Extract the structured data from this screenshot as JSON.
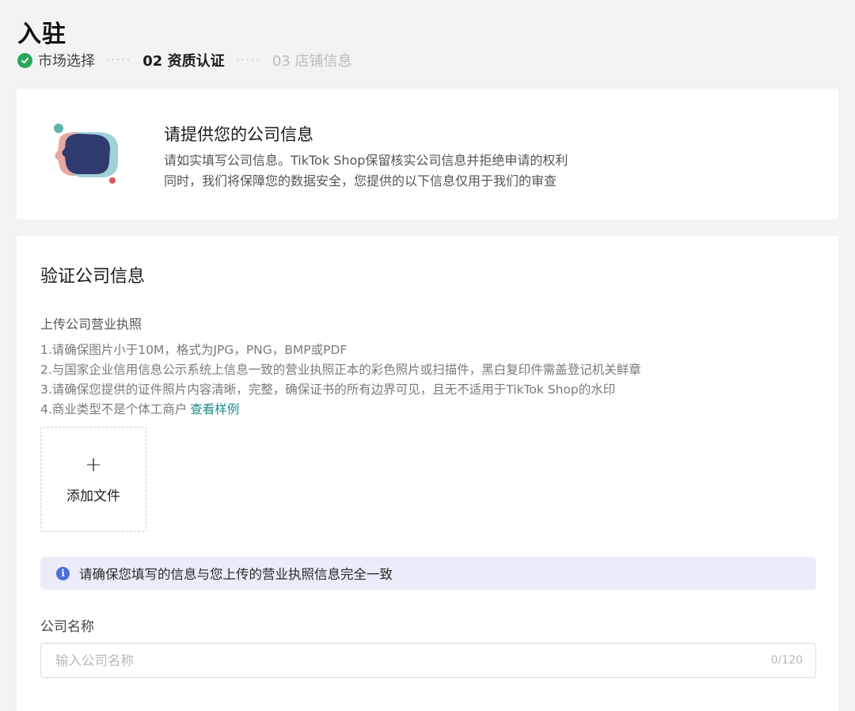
{
  "page": {
    "title": "入驻"
  },
  "steps": [
    {
      "label": "市场选择",
      "status": "done"
    },
    {
      "label": "02 资质认证",
      "status": "active"
    },
    {
      "label": "03 店铺信息",
      "status": "pending"
    }
  ],
  "step_separator": "·····",
  "intro": {
    "title": "请提供您的公司信息",
    "line1": "请如实填写公司信息。TikTok Shop保留核实公司信息并拒绝申请的权利",
    "line2": "同时，我们将保障您的数据安全，您提供的以下信息仅用于我们的审查"
  },
  "form": {
    "section_title": "验证公司信息",
    "upload_label": "上传公司营业执照",
    "requirements": [
      "1.请确保图片小于10M，格式为JPG，PNG，BMP或PDF",
      "2.与国家企业信用信息公示系统上信息一致的营业执照正本的彩色照片或扫描件，黑白复印件需盖登记机关鲜章",
      "3.请确保您提供的证件照片内容清晰，完整，确保证书的所有边界可见，且无不适用于TikTok Shop的水印",
      "4.商业类型不是个体工商户"
    ],
    "sample_link": "查看样例",
    "upload_button": "添加文件",
    "notice": "请确保您填写的信息与您上传的营业执照信息完全一致",
    "company_name_label": "公司名称",
    "company_name_placeholder": "输入公司名称",
    "company_name_value": "",
    "char_count": "0/120"
  },
  "colors": {
    "success": "#2aa55a",
    "link": "#1b8c8c",
    "info": "#4a6fd8",
    "notice_bg": "#eaedf9"
  }
}
